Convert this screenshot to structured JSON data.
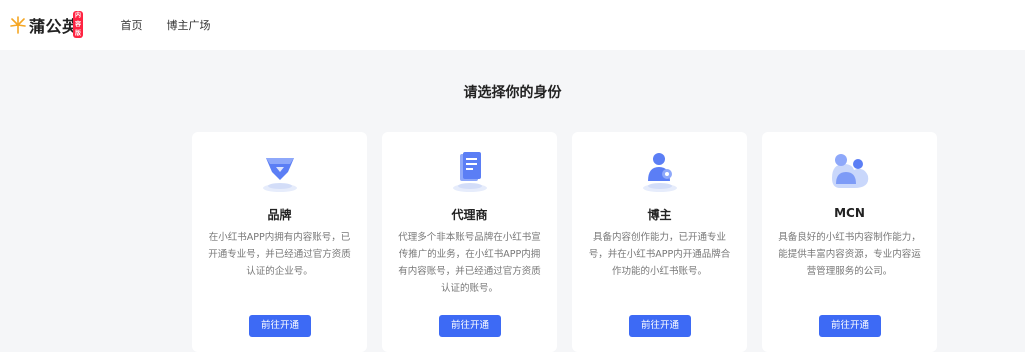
{
  "header": {
    "logo_text": "蒲公英",
    "logo_badge": "内容版",
    "nav": [
      {
        "label": "首页"
      },
      {
        "label": "博主广场"
      }
    ]
  },
  "main": {
    "title": "请选择你的身份",
    "cards": [
      {
        "title": "品牌",
        "icon": "diamond-icon",
        "description": "在小红书APP内拥有内容账号，已开通专业号，并已经通过官方资质认证的企业号。",
        "button": "前往开通"
      },
      {
        "title": "代理商",
        "icon": "document-icon",
        "description": "代理多个非本账号品牌在小红书宣传推广的业务，在小红书APP内拥有内容账号，并已经通过官方资质认证的账号。",
        "button": "前往开通"
      },
      {
        "title": "博主",
        "icon": "user-icon",
        "description": "具备内容创作能力，已开通专业号，并在小红书APP内开通品牌合作功能的小红书账号。",
        "button": "前往开通"
      },
      {
        "title": "MCN",
        "icon": "group-icon",
        "description": "具备良好的小红书内容制作能力，能提供丰富内容资源，专业内容运营管理服务的公司。",
        "button": "前往开通"
      }
    ]
  },
  "colors": {
    "accent": "#3d6af5",
    "brand": "#f5a623",
    "badge": "#ff2442",
    "background": "#f5f6f8"
  }
}
